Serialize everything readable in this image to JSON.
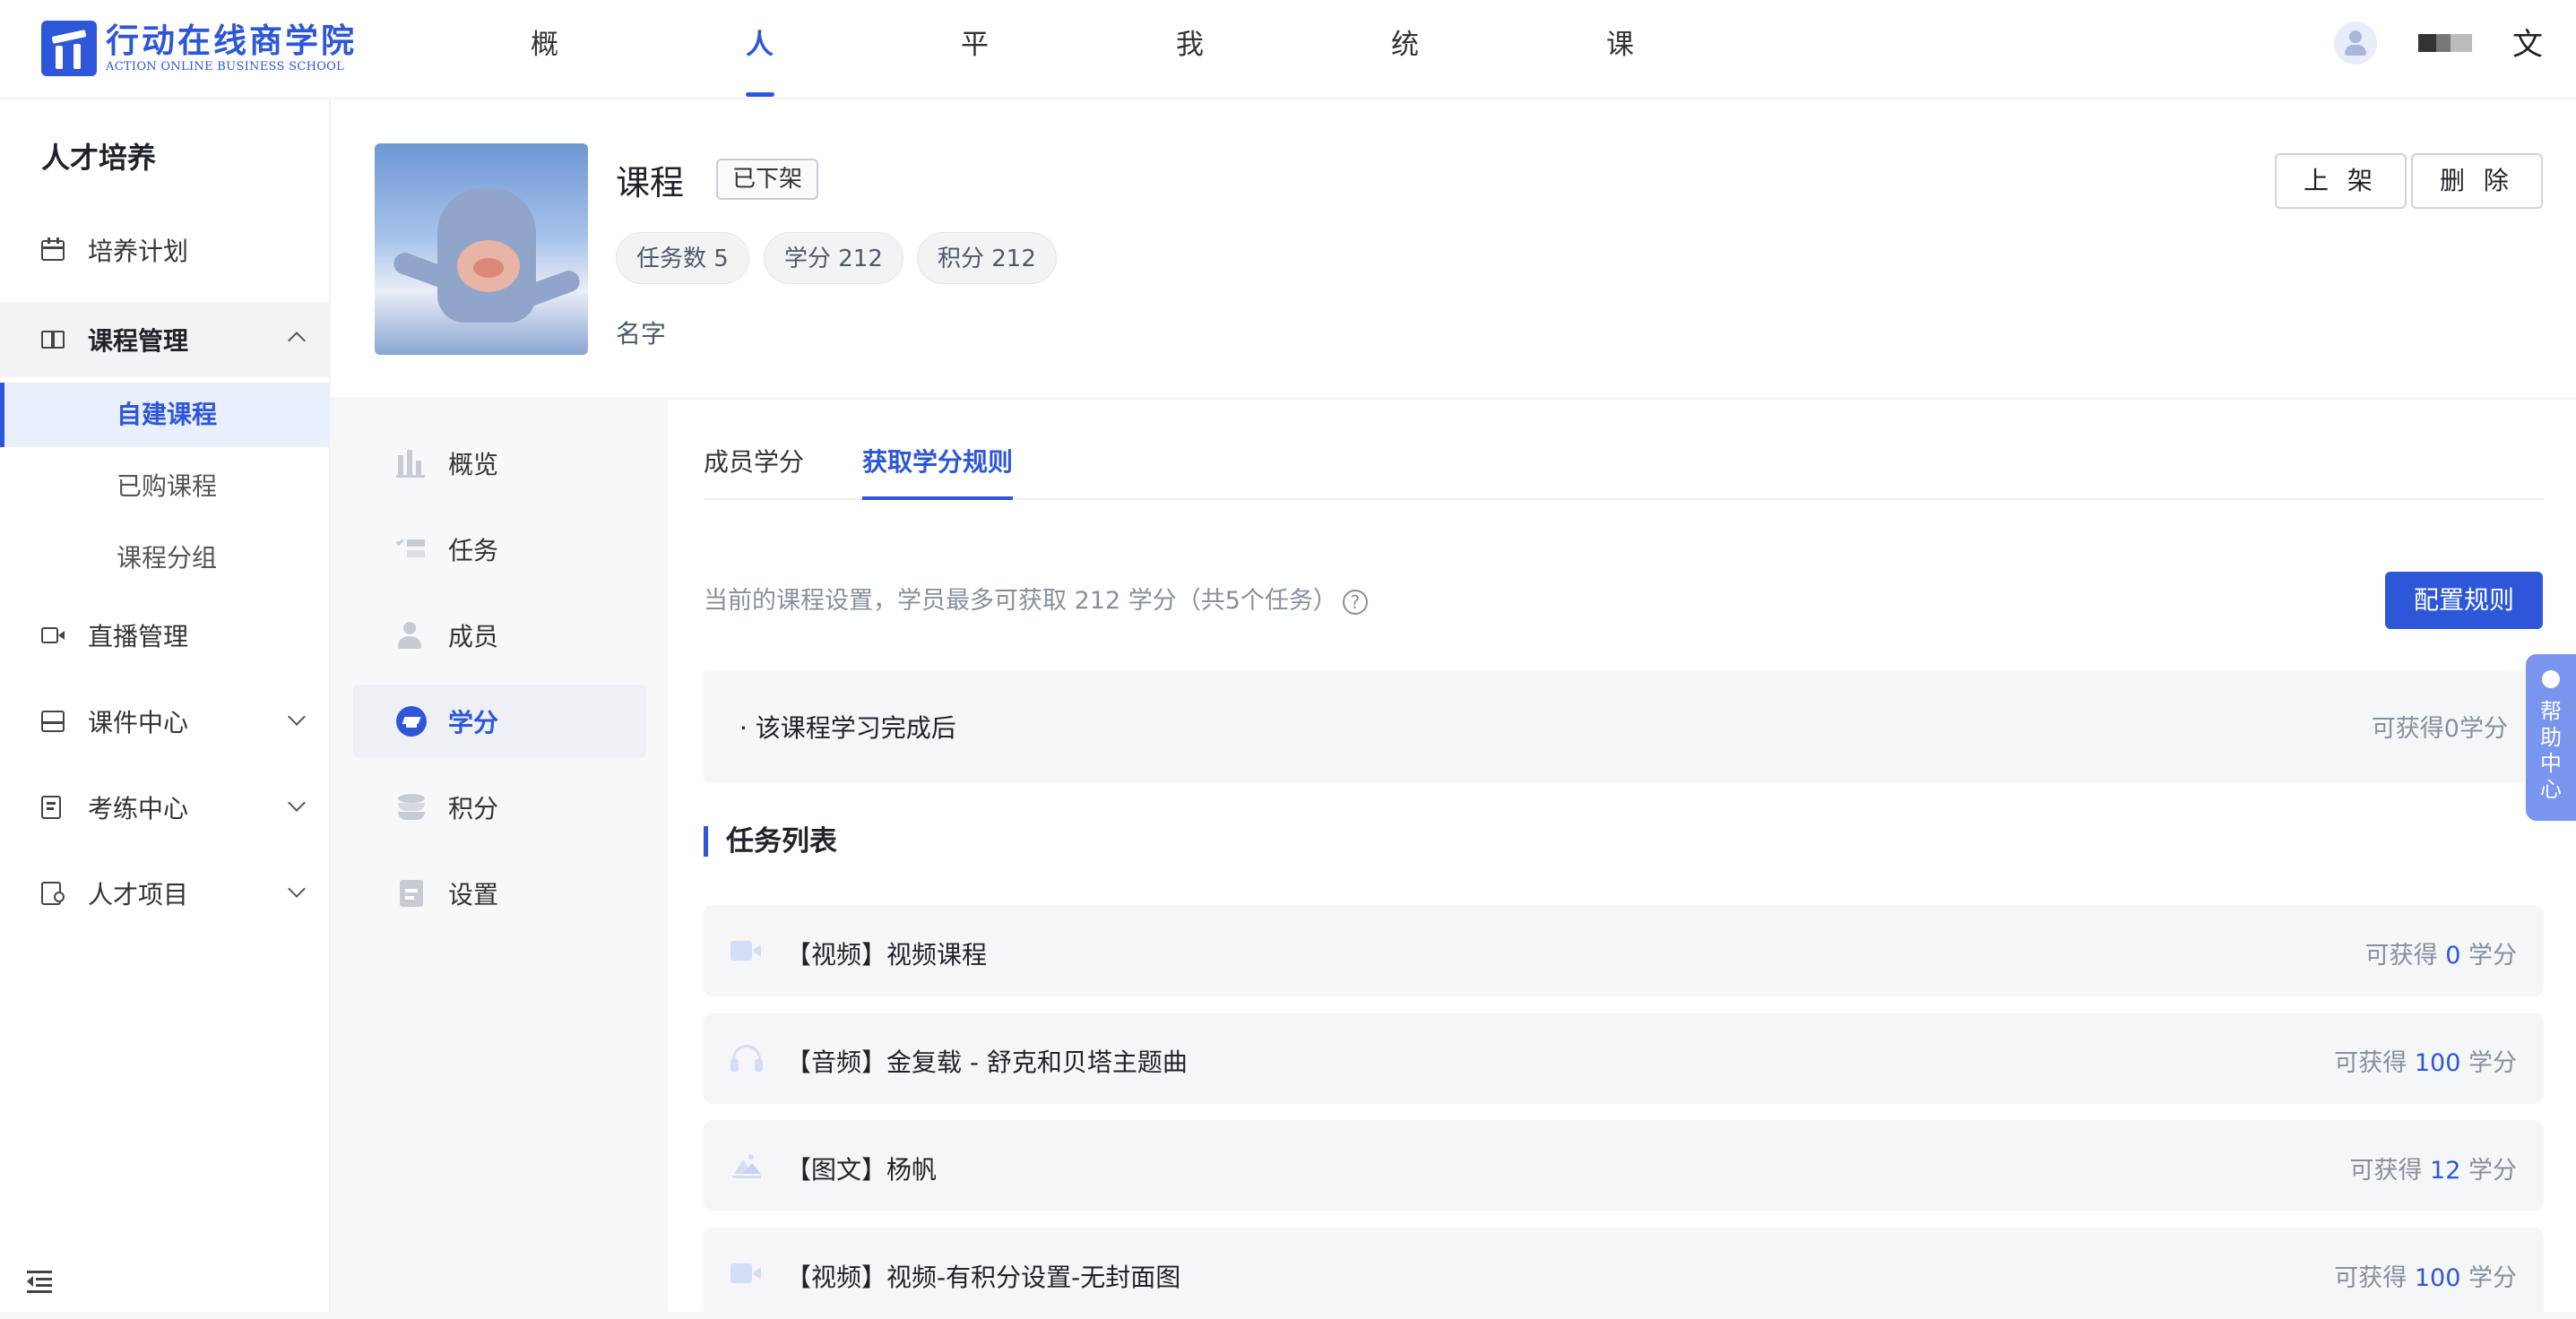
{
  "brand": {
    "name_cn": "行动在线商学院",
    "name_en": "ACTION ONLINE BUSINESS SCHOOL",
    "color": "#2d57d8"
  },
  "main_nav": [
    {
      "label": "概况总览",
      "active": false
    },
    {
      "label": "人才培养",
      "active": true
    },
    {
      "label": "平台运营",
      "active": false
    },
    {
      "label": "我的企业",
      "active": false
    },
    {
      "label": "统计中心",
      "active": false
    },
    {
      "label": "课程商城",
      "active": false
    }
  ],
  "topbar": {
    "avatar_icon": "user-avatar",
    "translate_icon": "translate-icon"
  },
  "sidebar": {
    "title": "人才培养",
    "items": [
      {
        "label": "培养计划",
        "icon": "calendar-icon"
      },
      {
        "label": "课程管理",
        "icon": "book-icon",
        "expanded": true
      },
      {
        "label": "直播管理",
        "icon": "video-camera-icon"
      },
      {
        "label": "课件中心",
        "icon": "inbox-icon"
      },
      {
        "label": "考练中心",
        "icon": "exam-icon"
      },
      {
        "label": "人才项目",
        "icon": "talent-icon"
      }
    ],
    "sub_items": [
      {
        "label": "自建课程",
        "active": true
      },
      {
        "label": "已购课程",
        "active": false
      },
      {
        "label": "课程分组",
        "active": false
      }
    ]
  },
  "course": {
    "title": "课程",
    "status": "已下架",
    "stats": [
      "任务数 5",
      "学分 212",
      "积分 212"
    ],
    "name_label": "名字",
    "actions": {
      "publish": "上 架",
      "delete": "删 除"
    }
  },
  "inner_nav": [
    {
      "label": "概览",
      "icon": "bar-chart-icon",
      "active": false
    },
    {
      "label": "任务",
      "icon": "task-list-icon",
      "active": false
    },
    {
      "label": "成员",
      "icon": "members-icon",
      "active": false
    },
    {
      "label": "学分",
      "icon": "graduation-cap-icon",
      "active": true
    },
    {
      "label": "积分",
      "icon": "coins-icon",
      "active": false
    },
    {
      "label": "设置",
      "icon": "settings-icon",
      "active": false
    }
  ],
  "tabs": [
    {
      "label": "成员学分",
      "active": false
    },
    {
      "label": "获取学分规则",
      "active": true
    }
  ],
  "summary": "当前的课程设置，学员最多可获取 212 学分（共5个任务）",
  "config_button": "配置规则",
  "completion_rule": {
    "text": "· 该课程学习完成后",
    "credit": "可获得0学分"
  },
  "task_section_title": "任务列表",
  "credit_prefix": "可获得",
  "credit_suffix": "学分",
  "tasks": [
    {
      "name": "【视频】视频课程",
      "icon": "video-icon",
      "credit": "0"
    },
    {
      "name": "【音频】金复载 - 舒克和贝塔主题曲",
      "icon": "headphones-icon",
      "credit": "100"
    },
    {
      "name": "【图文】杨帆",
      "icon": "image-icon",
      "credit": "12"
    },
    {
      "name": "【视频】视频-有积分设置-无封面图",
      "icon": "video-icon",
      "credit": "100"
    }
  ],
  "help_center": "帮助中心"
}
